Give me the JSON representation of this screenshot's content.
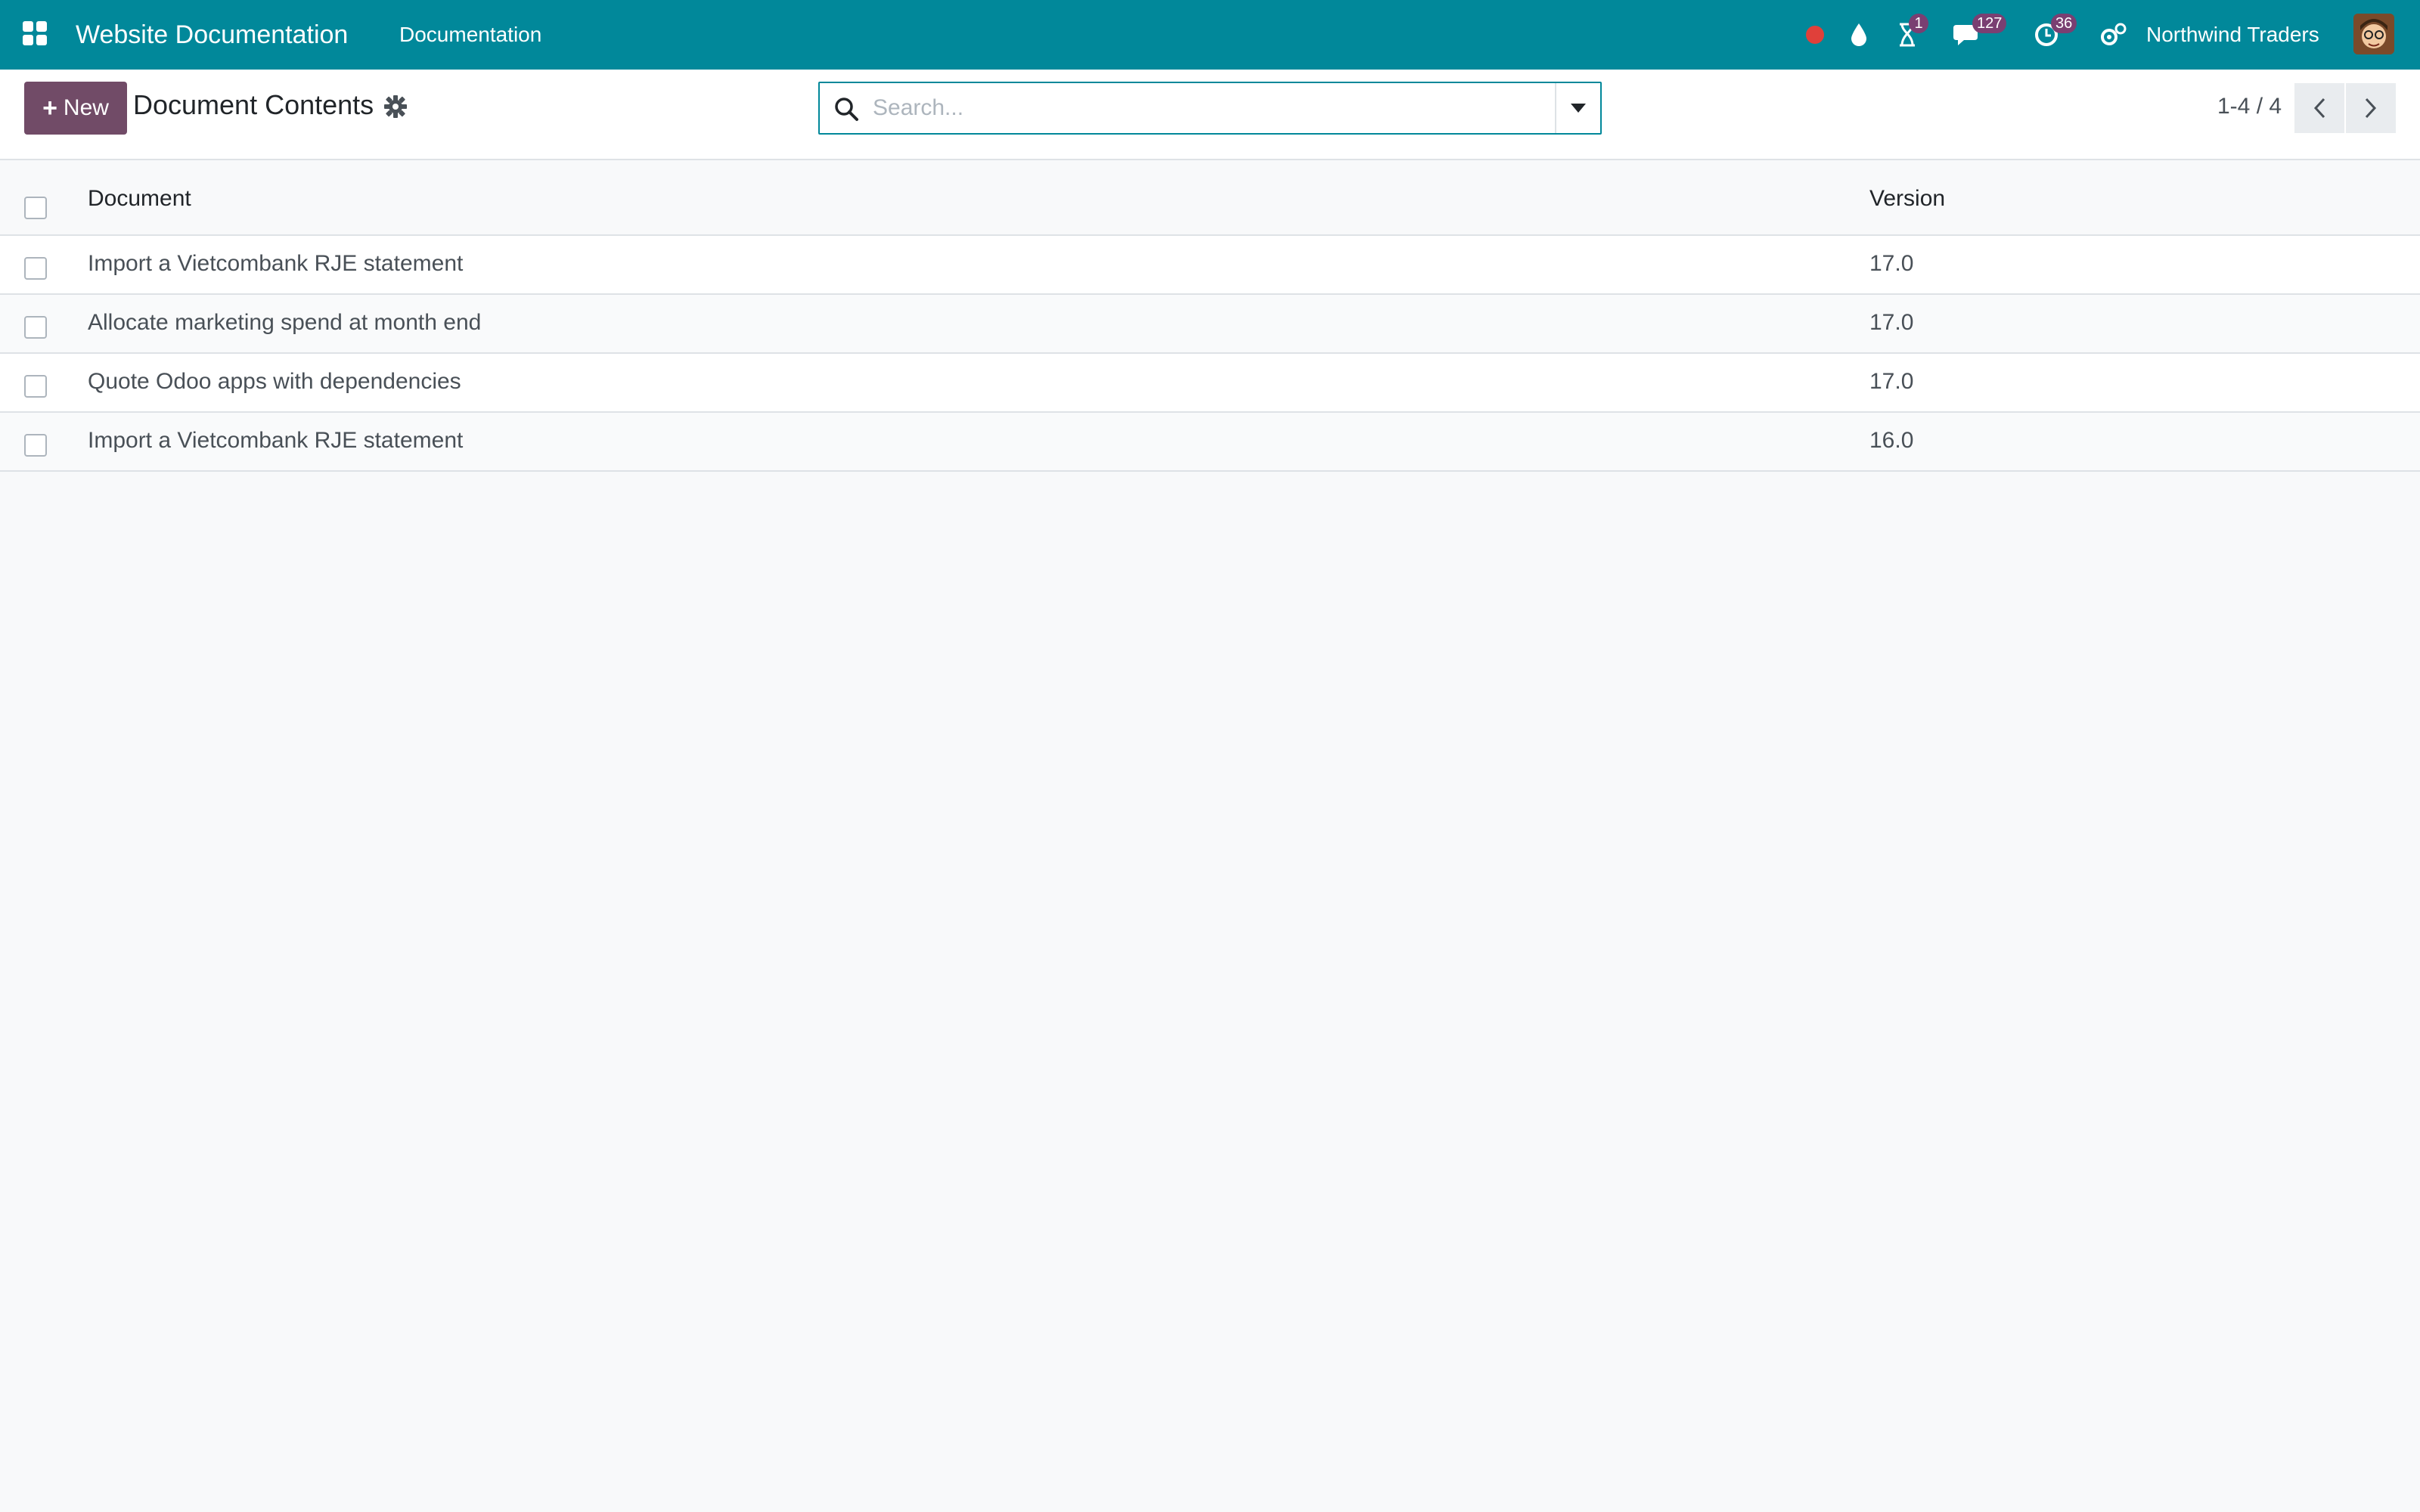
{
  "navbar": {
    "app_title": "Website Documentation",
    "menu": [
      "Documentation"
    ],
    "systray": {
      "recording_icon": "red-dot-icon",
      "debug_icon": "drop-icon",
      "activity_badge": "1",
      "messages_badge": "127",
      "clock_badge": "36",
      "settings_icon": "gears-icon"
    },
    "company": "Northwind Traders",
    "colors": {
      "navbar": "#01889a",
      "badge": "#7a3f72"
    }
  },
  "control_panel": {
    "new_button": "New",
    "breadcrumb": "Document Contents",
    "search_placeholder": "Search...",
    "pager": "1-4 / 4",
    "colors": {
      "primary": "#714b67"
    }
  },
  "table": {
    "columns": [
      "Document",
      "Version"
    ],
    "rows": [
      {
        "document": "Import a Vietcombank RJE statement",
        "version": "17.0"
      },
      {
        "document": "Allocate marketing spend at month end",
        "version": "17.0"
      },
      {
        "document": "Quote Odoo apps with dependencies",
        "version": "17.0"
      },
      {
        "document": "Import a Vietcombank RJE statement",
        "version": "16.0"
      }
    ]
  }
}
